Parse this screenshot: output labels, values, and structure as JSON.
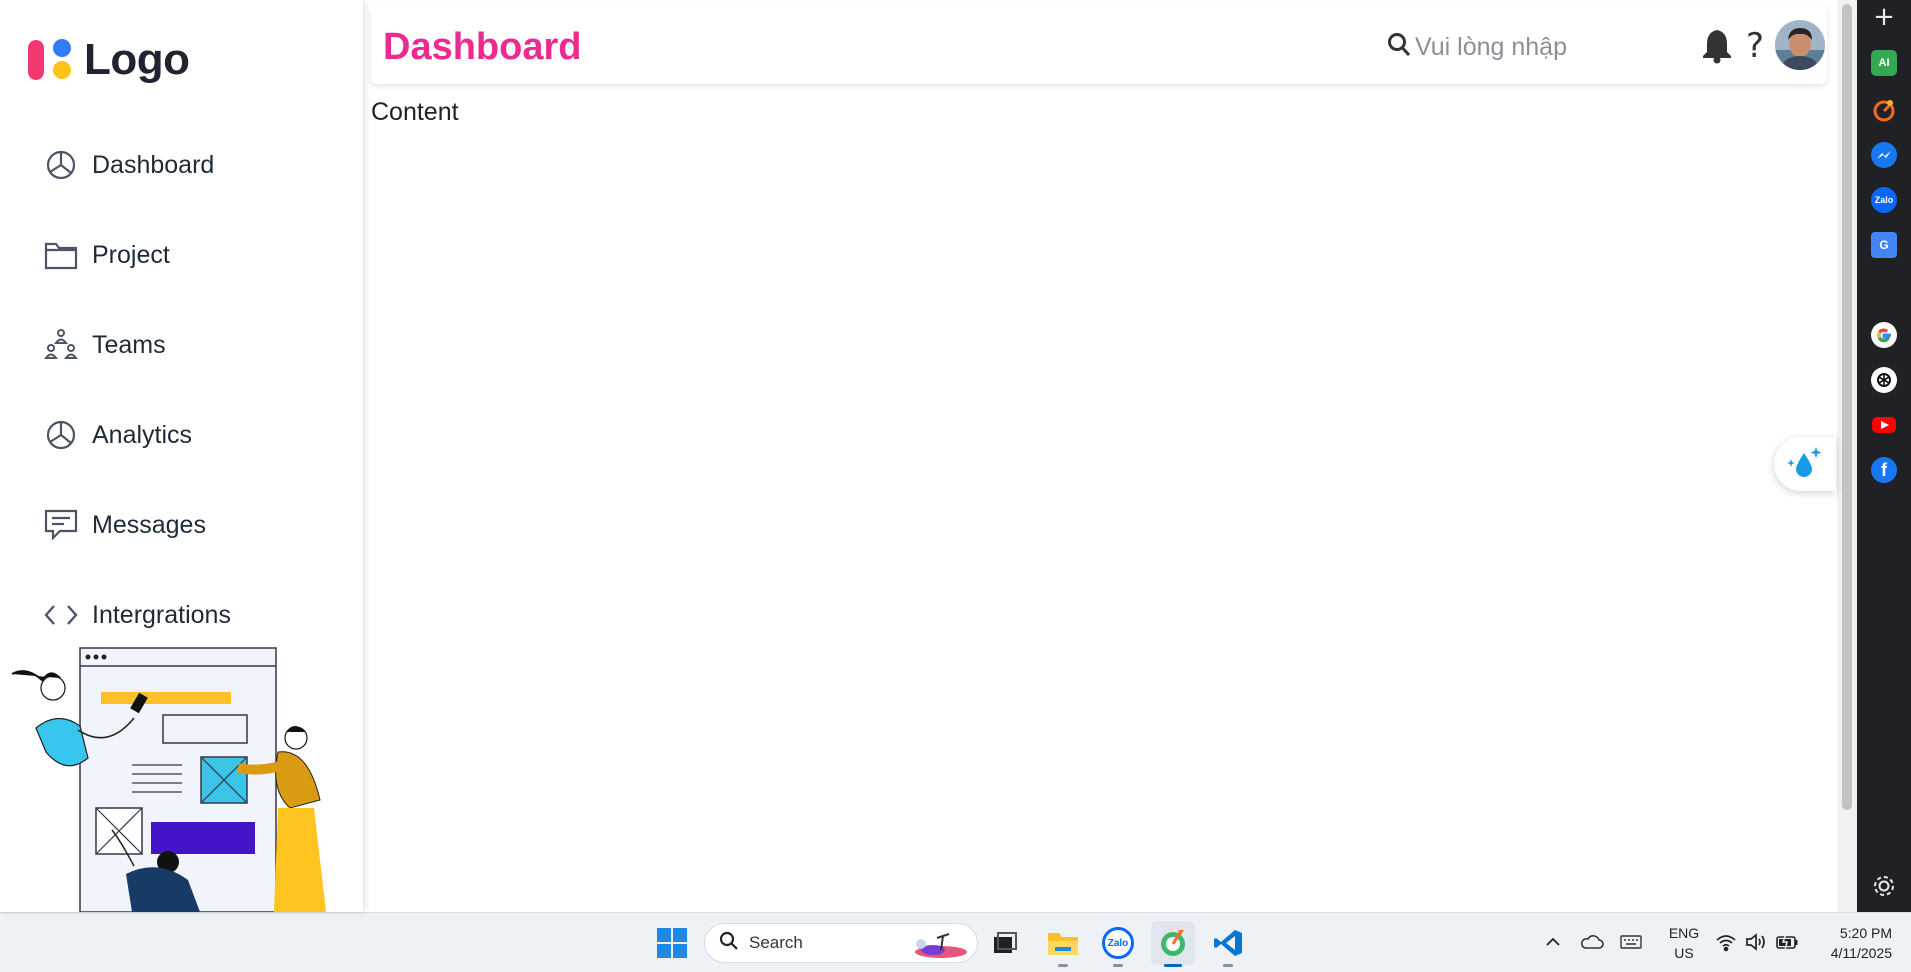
{
  "sidebar": {
    "logo_text": "Logo",
    "items": [
      {
        "label": "Dashboard",
        "icon": "pie-chart-icon"
      },
      {
        "label": "Project",
        "icon": "folder-icon"
      },
      {
        "label": "Teams",
        "icon": "teams-icon"
      },
      {
        "label": "Analytics",
        "icon": "pie-chart-icon"
      },
      {
        "label": "Messages",
        "icon": "message-icon"
      },
      {
        "label": "Intergrations",
        "icon": "code-icon"
      }
    ]
  },
  "header": {
    "title": "Dashboard",
    "search_placeholder": "Vui lòng nhập",
    "help_symbol": "?"
  },
  "main": {
    "content_text": "Content"
  },
  "right_bar": {
    "icons": [
      "ai-chat-icon",
      "timer-icon",
      "messenger-icon",
      "zalo-icon",
      "translate-icon",
      "google-icon",
      "chatgpt-icon",
      "youtube-icon",
      "facebook-icon"
    ],
    "zalo_label": "Zalo",
    "ai_label": "AI"
  },
  "taskbar": {
    "search_label": "Search",
    "apps": [
      "task-view-icon",
      "file-explorer-icon",
      "zalo-icon",
      "app-icon",
      "vscode-icon"
    ],
    "zalo_label": "Zalo",
    "lang_line1": "ENG",
    "lang_line2": "US",
    "time": "5:20 PM",
    "date": "4/11/2025"
  },
  "colors": {
    "title_pink": "#ec2a8f",
    "sidebar_text": "#1f2a37",
    "browser_bar": "#202124",
    "taskbar": "#eef1f6"
  }
}
